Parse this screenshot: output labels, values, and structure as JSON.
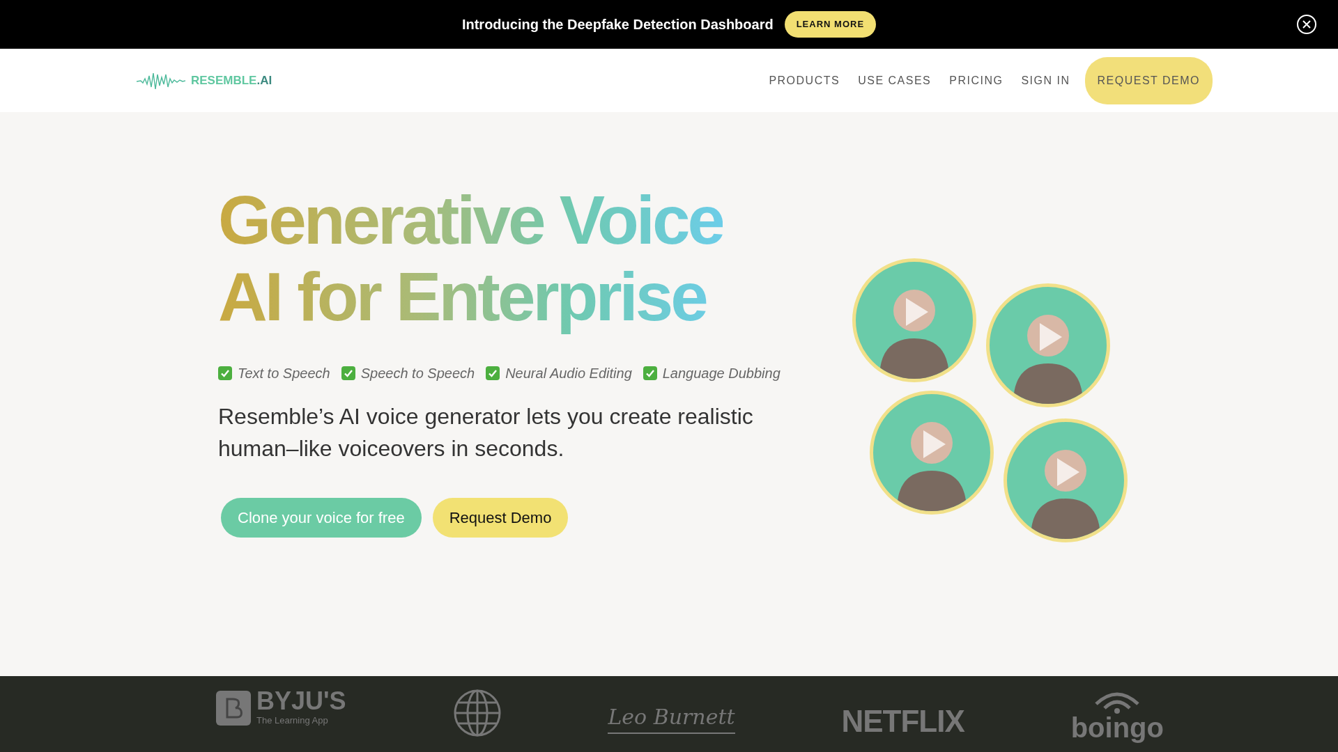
{
  "banner": {
    "text": "Introducing the Deepfake Detection Dashboard",
    "button": "LEARN MORE"
  },
  "nav": {
    "logo": {
      "name": "RESEMBLE",
      "suffix": ".AI"
    },
    "links": [
      "PRODUCTS",
      "USE CASES",
      "PRICING",
      "SIGN IN"
    ],
    "cta": "REQUEST DEMO"
  },
  "hero": {
    "title_lines": [
      "Generative Voice",
      "AI for Enterprise"
    ],
    "features": [
      "Text to Speech",
      "Speech to Speech",
      "Neural Audio Editing",
      "Language Dubbing"
    ],
    "description": "Resemble’s AI voice generator lets you create realistic human–like voiceovers in seconds.",
    "buttons": [
      {
        "label": "Clone your voice for free",
        "kind": "primary"
      },
      {
        "label": "Request Demo",
        "kind": "secondary"
      }
    ]
  },
  "logos": [
    {
      "kind": "byjus",
      "text": "BYJU'S",
      "subtext": "The Learning App"
    },
    {
      "kind": "globe"
    },
    {
      "kind": "script",
      "text": "Leo Burnett"
    },
    {
      "kind": "wordmark",
      "text": "NETFLIX"
    },
    {
      "kind": "wifi",
      "text": "boingo"
    }
  ]
}
